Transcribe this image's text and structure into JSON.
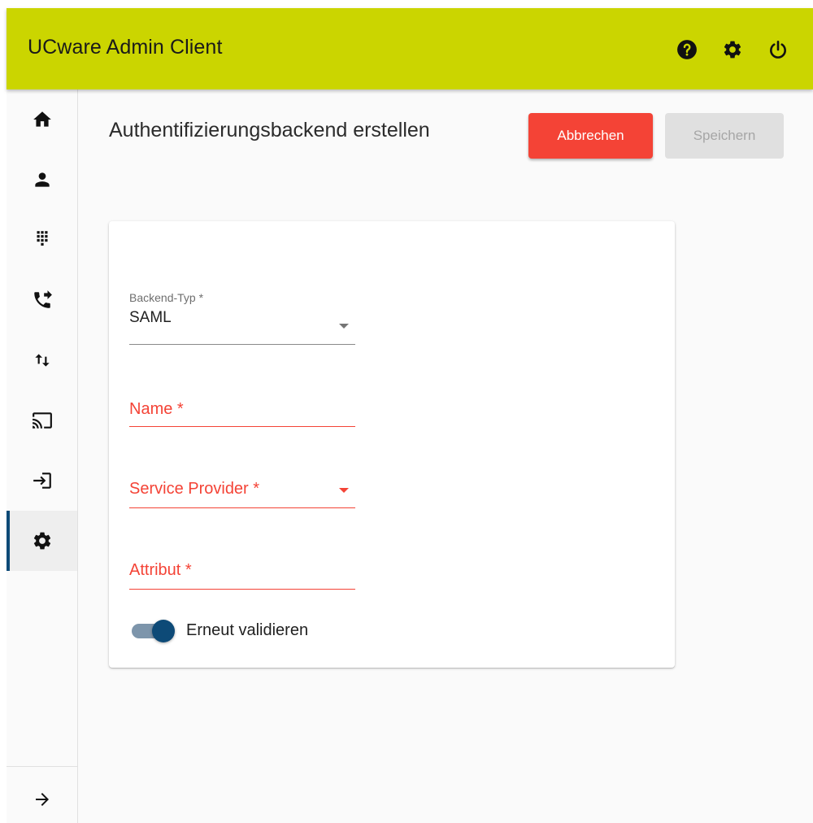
{
  "app": {
    "title": "UCware Admin Client",
    "accent_color": "#cbd500",
    "top_icons": [
      "help-icon",
      "settings-icon",
      "power-icon"
    ]
  },
  "sidebar": {
    "items": [
      {
        "name": "home",
        "icon": "home-icon"
      },
      {
        "name": "users",
        "icon": "person-icon"
      },
      {
        "name": "dialpad",
        "icon": "dialpad-icon"
      },
      {
        "name": "call-forwarding",
        "icon": "phone-forward-icon"
      },
      {
        "name": "import-export",
        "icon": "import-export-icon"
      },
      {
        "name": "provisioning",
        "icon": "cast-icon"
      },
      {
        "name": "login",
        "icon": "login-icon"
      },
      {
        "name": "settings",
        "icon": "settings-icon",
        "active": true
      }
    ],
    "expand_icon": "arrow-right-icon",
    "active_color": "#0d4a77"
  },
  "page": {
    "title": "Authentifizierungsbackend erstellen",
    "cancel_label": "Abbrechen",
    "save_label": "Speichern",
    "save_disabled": true
  },
  "form": {
    "backend_type": {
      "label": "Backend-Typ *",
      "value": "SAML"
    },
    "name": {
      "label": "Name *",
      "value": ""
    },
    "service_provider": {
      "label": "Service Provider *",
      "value": ""
    },
    "attribute": {
      "label": "Attribut *",
      "value": ""
    },
    "revalidate": {
      "label": "Erneut validieren",
      "checked": true
    },
    "error_color": "#f44336"
  }
}
